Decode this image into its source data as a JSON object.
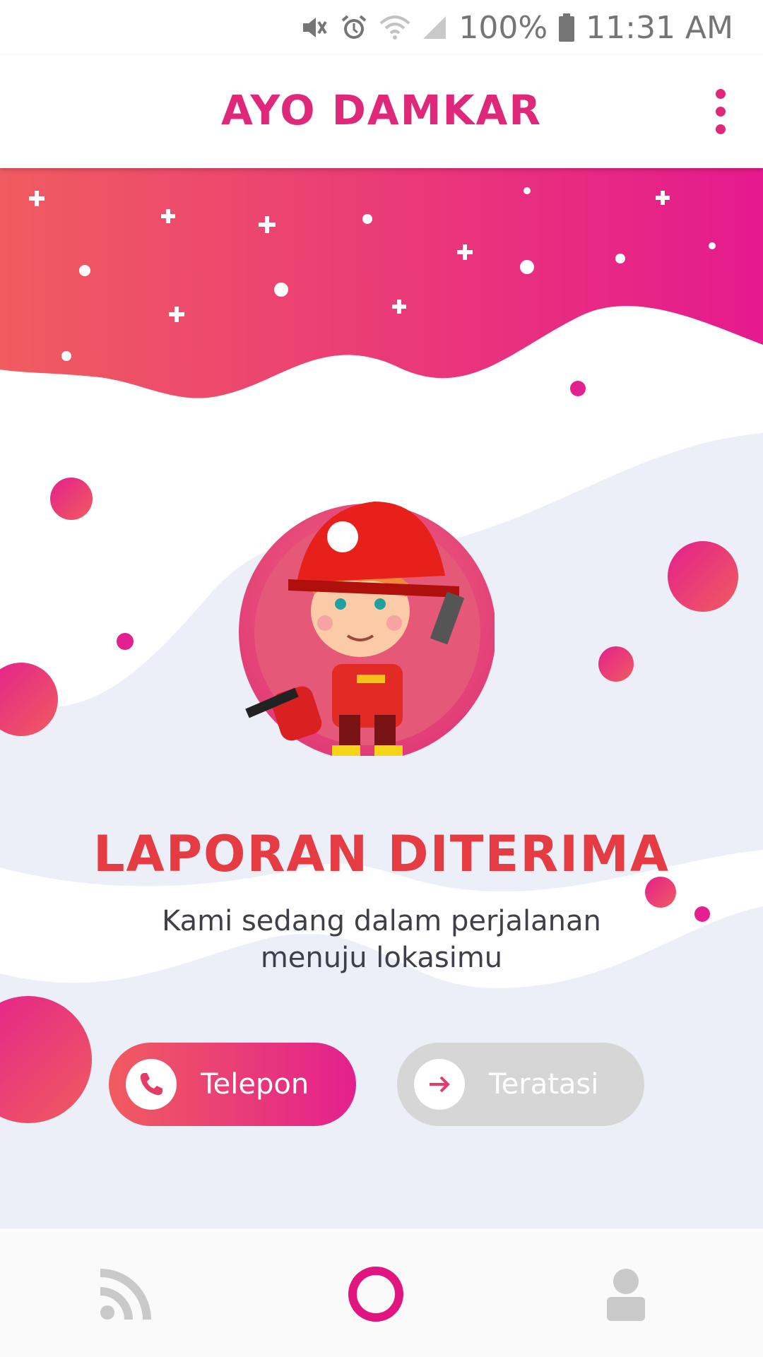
{
  "status_bar": {
    "battery": "100%",
    "time": "11:31 AM",
    "icons": [
      "mute-icon",
      "alarm-icon",
      "wifi-icon",
      "signal-icon",
      "battery-icon"
    ]
  },
  "app_bar": {
    "title": "AYO DAMKAR",
    "menu_icon": "more-vert-icon"
  },
  "main": {
    "illustration": "firefighter-illustration",
    "title": "LAPORAN DITERIMA",
    "subtitle": "Kami sedang dalam perjalanan menuju lokasimu",
    "buttons": [
      {
        "label": "Telepon",
        "icon": "phone-icon",
        "state": "active"
      },
      {
        "label": "Teratasi",
        "icon": "arrow-right-icon",
        "state": "disabled"
      }
    ]
  },
  "bottom_nav": {
    "items": [
      {
        "name": "feed",
        "icon": "rss-icon",
        "selected": false
      },
      {
        "name": "home",
        "icon": "ring-icon",
        "selected": true
      },
      {
        "name": "profile",
        "icon": "person-icon",
        "selected": false
      }
    ]
  },
  "colors": {
    "accent": "#e0287a",
    "title_red": "#e53b43",
    "gradient_start": "#f05c5f",
    "gradient_end": "#e3208d",
    "disabled_button": "#d6d6d6",
    "inactive_icon": "#c9c9c9",
    "wave_light": "#eceef8"
  }
}
